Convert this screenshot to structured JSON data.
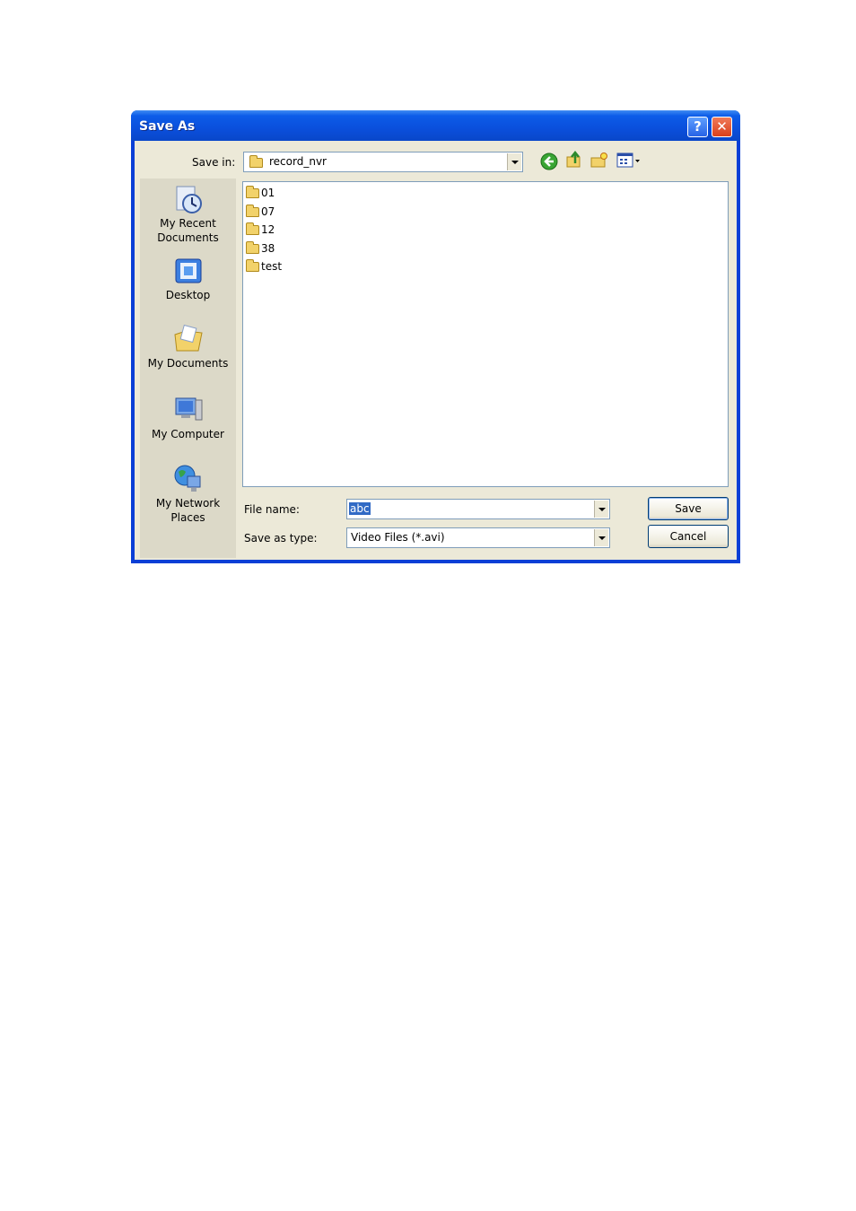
{
  "window": {
    "title": "Save As",
    "help_label": "?",
    "close_label": "✕"
  },
  "save_in": {
    "label": "Save in:",
    "value": "record_nvr"
  },
  "toolbar": {
    "back_icon": "back-arrow-icon",
    "up_icon": "up-folder-icon",
    "new_icon": "new-folder-icon",
    "views_icon": "views-menu-icon"
  },
  "places": [
    {
      "label": "My Recent Documents",
      "icon": "recent-documents-icon"
    },
    {
      "label": "Desktop",
      "icon": "desktop-icon"
    },
    {
      "label": "My Documents",
      "icon": "my-documents-icon"
    },
    {
      "label": "My Computer",
      "icon": "my-computer-icon"
    },
    {
      "label": "My Network Places",
      "icon": "network-places-icon"
    }
  ],
  "files": [
    "01",
    "07",
    "12",
    "38",
    "test"
  ],
  "file_name": {
    "label": "File name:",
    "value": "abc"
  },
  "save_type": {
    "label": "Save as type:",
    "value": "Video Files (*.avi)"
  },
  "buttons": {
    "save": "Save",
    "cancel": "Cancel"
  },
  "colors": {
    "titlebar": "#0a4fdc",
    "dialog_bg": "#ece9d8",
    "selection": "#316ac5"
  }
}
